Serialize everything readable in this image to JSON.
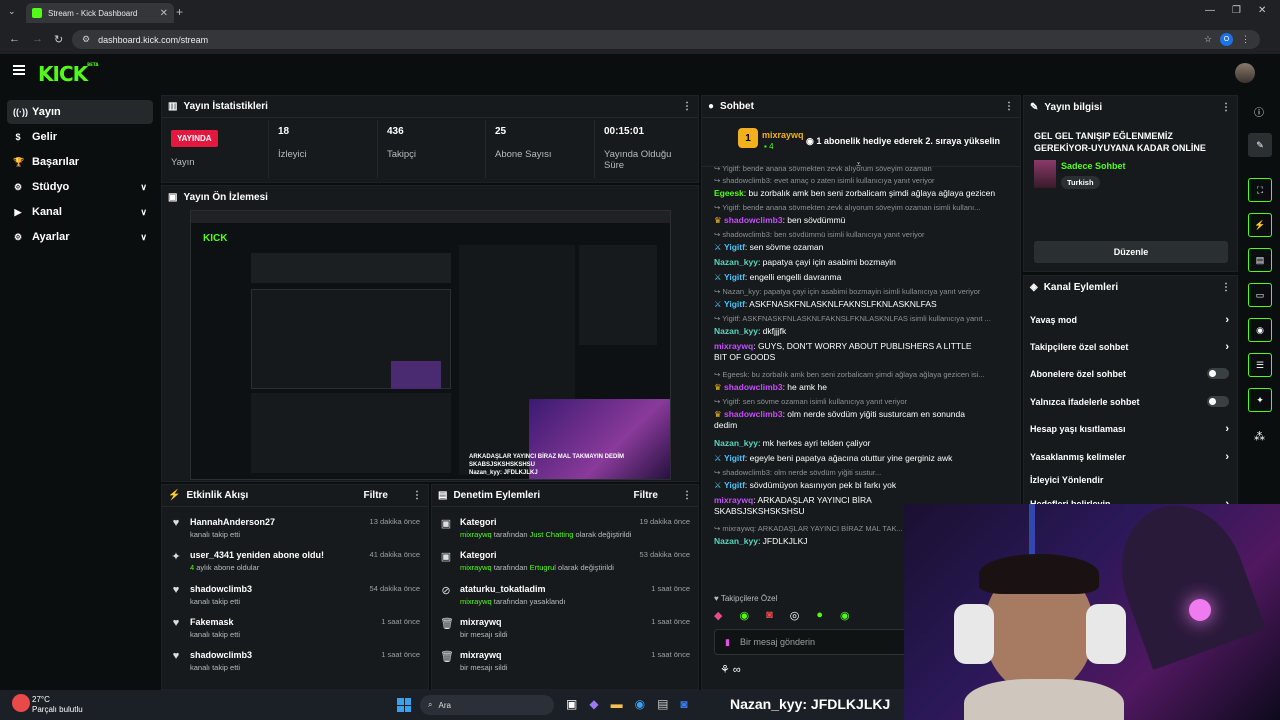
{
  "browser": {
    "tab_title": "Stream - Kick Dashboard",
    "url": "dashboard.kick.com/stream",
    "profile_initial": "O"
  },
  "brand": {
    "logo": "KICK",
    "beta": "BETA"
  },
  "sidebar": {
    "items": [
      {
        "label": "Yayın",
        "icon": "broadcast-icon"
      },
      {
        "label": "Gelir",
        "icon": "dollar-icon"
      },
      {
        "label": "Başarılar",
        "icon": "trophy-icon"
      },
      {
        "label": "Stüdyo",
        "icon": "studio-icon"
      },
      {
        "label": "Kanal",
        "icon": "camera-icon"
      },
      {
        "label": "Ayarlar",
        "icon": "gear-icon"
      }
    ]
  },
  "stats": {
    "title": "Yayın İstatistikleri",
    "live_badge": "YAYINDA",
    "live_label": "Yayın",
    "items": [
      {
        "value": "18",
        "label": "İzleyici"
      },
      {
        "value": "436",
        "label": "Takipçi"
      },
      {
        "value": "25",
        "label": "Abone Sayısı"
      },
      {
        "value": "00:15:01",
        "label": "Yayında Olduğu Süre"
      }
    ]
  },
  "preview": {
    "title": "Yayın Ön İzlemesi",
    "caption": "ARKADAŞLAR YAYINCI BİRAZ MAL TAKMAYIN DEDİM SKABSJSKSHSKSHSU",
    "caption_user": "Nazan_kyy: JFDLKJLKJ"
  },
  "activity": {
    "title": "Etkinlik Akışı",
    "filter": "Filtre",
    "items": [
      {
        "title": "HannahAnderson27",
        "sub": "kanalı takip etti",
        "time": "13 dakika önce",
        "icon": "heart-icon"
      },
      {
        "title": "user_4341 yeniden abone oldu!",
        "sub_num": "4",
        "sub": "aylık abone oldular",
        "time": "41 dakika önce",
        "icon": "sparkle-icon"
      },
      {
        "title": "shadowclimb3",
        "sub": "kanalı takip etti",
        "time": "54 dakika önce",
        "icon": "heart-icon"
      },
      {
        "title": "Fakemask",
        "sub": "kanalı takip etti",
        "time": "1 saat önce",
        "icon": "heart-icon"
      },
      {
        "title": "shadowclimb3",
        "sub": "kanalı takip etti",
        "time": "1 saat önce",
        "icon": "heart-icon"
      }
    ]
  },
  "moderation": {
    "title": "Denetim Eylemleri",
    "filter": "Filtre",
    "items": [
      {
        "title": "Kategori",
        "user": "mixraywq",
        "mid": "tarafından",
        "highlight": "Just Chatting",
        "tail": "olarak değiştirildi",
        "time": "19 dakika önce",
        "icon": "category-icon"
      },
      {
        "title": "Kategori",
        "user": "mixraywq",
        "mid": "tarafından",
        "highlight": "Ertugrul",
        "tail": "olarak değiştirildi",
        "time": "53 dakika önce",
        "icon": "category-icon"
      },
      {
        "title": "ataturku_tokatladim",
        "user": "mixraywq",
        "mid": "tarafından yasaklandı",
        "highlight": "",
        "tail": "",
        "time": "1 saat önce",
        "icon": "ban-icon"
      },
      {
        "title": "mixraywq",
        "user": "",
        "mid": "bir mesajı sildi",
        "highlight": "",
        "tail": "",
        "time": "1 saat önce",
        "icon": "trash-icon"
      },
      {
        "title": "mixraywq",
        "user": "",
        "mid": "bir mesajı sildi",
        "highlight": "",
        "tail": "",
        "time": "1 saat önce",
        "icon": "trash-icon"
      }
    ]
  },
  "chat": {
    "title": "Sohbet",
    "pinned_user": "mixraywq",
    "pinned_count": "4",
    "pinned_rank": "1",
    "pinned_msg": "1 abonelik hediye ederek 2. sıraya yükselin",
    "lines": [
      {
        "type": "reply",
        "text": "Yigitf: bende anana sövmekten zevk alıyorum söveyim ozaman"
      },
      {
        "type": "reply",
        "text": "shadowclimb3: evet amaç o zaten isimli kullanıcıya yanıt veriyor"
      },
      {
        "type": "msg",
        "user": "Egeesk",
        "color": "green",
        "text": ": bu zorbalık amk ben seni zorbalicam şimdi ağlaya ağlaya gezicen"
      },
      {
        "type": "reply",
        "text": "Yigitf: bende anana sövmekten zevk alıyorum söveyim ozaman isimli kullanı..."
      },
      {
        "type": "msg",
        "user": "shadowclimb3",
        "color": "purple",
        "text": ": ben sövdümmü",
        "badge": "crown"
      },
      {
        "type": "reply",
        "text": "shadowclimb3: ben sövdümmü isimli kullanıcıya yanıt veriyor"
      },
      {
        "type": "msg",
        "user": "Yigitf",
        "color": "blue",
        "text": ": sen sövme ozaman",
        "badge": "mod"
      },
      {
        "type": "msg",
        "user": "Nazan_kyy",
        "color": "teal",
        "text": ": papatya çayi için asabimi bozmayin"
      },
      {
        "type": "msg",
        "user": "Yigitf",
        "color": "blue",
        "text": ": engelli engelli davranma",
        "badge": "mod"
      },
      {
        "type": "reply",
        "text": "Nazan_kyy: papatya çayi için asabimi bozmayin isimli kullanıcıya yanıt veriyor"
      },
      {
        "type": "msg",
        "user": "Yigitf",
        "color": "blue",
        "text": ": ASKFNASKFNLASKNLFAKNSLFKNLASKNLFAS",
        "badge": "mod"
      },
      {
        "type": "reply",
        "text": "Yigitf: ASKFNASKFNLASKNLFAKNSLFKNLASKNLFAS isimli kullanıcıya yanıt ..."
      },
      {
        "type": "msg",
        "user": "Nazan_kyy",
        "color": "teal",
        "text": ": dkfjjjfk"
      },
      {
        "type": "msg2",
        "user": "mixraywq",
        "color": "purple",
        "text": ": GUYS, DON'T WORRY ABOUT PUBLISHERS A LITTLE",
        "cont": "BIT OF GOODS"
      },
      {
        "type": "reply",
        "text": "Egeesk: bu zorbalık amk ben seni zorbalicam şimdi ağlaya ağlaya gezicen isi..."
      },
      {
        "type": "msg",
        "user": "shadowclimb3",
        "color": "purple",
        "text": ": he amk he",
        "badge": "crown"
      },
      {
        "type": "reply",
        "text": "Yigitf: sen sövme ozaman isimli kullanıcıya yanıt veriyor"
      },
      {
        "type": "msg2",
        "user": "shadowclimb3",
        "color": "purple",
        "text": ": olm nerde sövdüm yiğiti susturcam en sonunda",
        "cont": "dedim",
        "badge": "crown"
      },
      {
        "type": "msg",
        "user": "Nazan_kyy",
        "color": "teal",
        "text": ": mk herkes ayri telden çaliyor"
      },
      {
        "type": "msg",
        "user": "Yigitf",
        "color": "blue",
        "text": ": egeyle beni papatya ağacına otuttur yine gerginiz awk",
        "badge": "mod"
      },
      {
        "type": "reply",
        "text": "shadowclimb3: olm nerde sövdüm yiğiti sustur..."
      },
      {
        "type": "msg",
        "user": "Yigitf",
        "color": "blue",
        "text": ": sövdümüyon kasınıyon pek bi farkı yok",
        "badge": "mod"
      },
      {
        "type": "msg2",
        "user": "mixraywq",
        "color": "purple",
        "text": ": ARKADAŞLAR YAYINCI BİRA",
        "cont": "SKABSJSKSHSKSHSU"
      },
      {
        "type": "reply",
        "text": "mixraywq: ARKADAŞLAR YAYINCI BİRAZ MAL TAK..."
      },
      {
        "type": "msg",
        "user": "Nazan_kyy",
        "color": "teal",
        "text": ": JFDLKJLKJ"
      }
    ],
    "mode_label": "Takipçilere Özel",
    "input_placeholder": "Bir mesaj gönderin"
  },
  "stream_info": {
    "title": "Yayın bilgisi",
    "stream_title": "GEL GEL TANIŞIP EĞLENMEMİZ GEREKİYOR-UYUYANA KADAR ONLİNE",
    "category": "Sadece Sohbet",
    "tag": "Turkish",
    "edit": "Düzenle"
  },
  "channel_actions": {
    "title": "Kanal Eylemleri",
    "items": [
      {
        "label": "Yavaş mod",
        "control": "arrow"
      },
      {
        "label": "Takipçilere özel sohbet",
        "control": "arrow"
      },
      {
        "label": "Abonelere özel sohbet",
        "control": "toggle"
      },
      {
        "label": "Yalnızca ifadelerle sohbet",
        "control": "toggle"
      },
      {
        "label": "Hesap yaşı kısıtlaması",
        "control": "arrow"
      },
      {
        "label": "Yasaklanmış kelimeler",
        "control": "arrow"
      },
      {
        "label": "İzleyici Yönlendir",
        "control": "none"
      },
      {
        "label": "Hedefleri belirleyin",
        "control": "arrow"
      }
    ]
  },
  "taskbar": {
    "weather_temp": "27°C",
    "weather_desc": "Parçalı bulutlu",
    "search": "Ara",
    "overlay_text": "Nazan_kyy: JFDLKJLKJ"
  }
}
